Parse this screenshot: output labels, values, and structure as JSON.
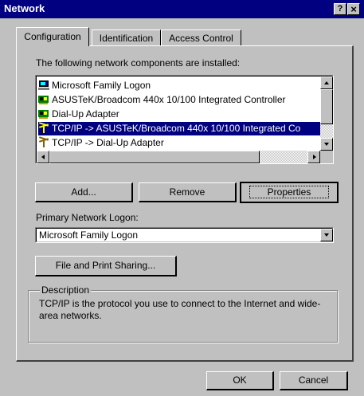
{
  "window": {
    "title": "Network",
    "help_glyph": "?",
    "close_glyph": "×"
  },
  "tabs": [
    {
      "label": "Configuration",
      "active": true
    },
    {
      "label": "Identification",
      "active": false
    },
    {
      "label": "Access Control",
      "active": false
    }
  ],
  "components": {
    "label": "The following network components are installed:",
    "items": [
      {
        "label": "Microsoft Family Logon",
        "icon": "computer-icon",
        "selected": false
      },
      {
        "label": "ASUSTeK/Broadcom 440x 10/100 Integrated Controller",
        "icon": "network-card-icon",
        "selected": false
      },
      {
        "label": "Dial-Up Adapter",
        "icon": "network-card-icon",
        "selected": false
      },
      {
        "label": "TCP/IP -> ASUSTeK/Broadcom 440x 10/100 Integrated Co",
        "icon": "protocol-icon",
        "selected": true
      },
      {
        "label": "TCP/IP -> Dial-Up Adapter",
        "icon": "protocol-icon",
        "selected": false
      }
    ]
  },
  "buttons": {
    "add": "Add...",
    "remove": "Remove",
    "properties": "Properties",
    "file_print": "File and Print Sharing...",
    "ok": "OK",
    "cancel": "Cancel"
  },
  "logon": {
    "label": "Primary Network Logon:",
    "value": "Microsoft Family Logon"
  },
  "description": {
    "label": "Description",
    "text": "TCP/IP is the protocol you use to connect to the Internet and wide-area networks."
  }
}
